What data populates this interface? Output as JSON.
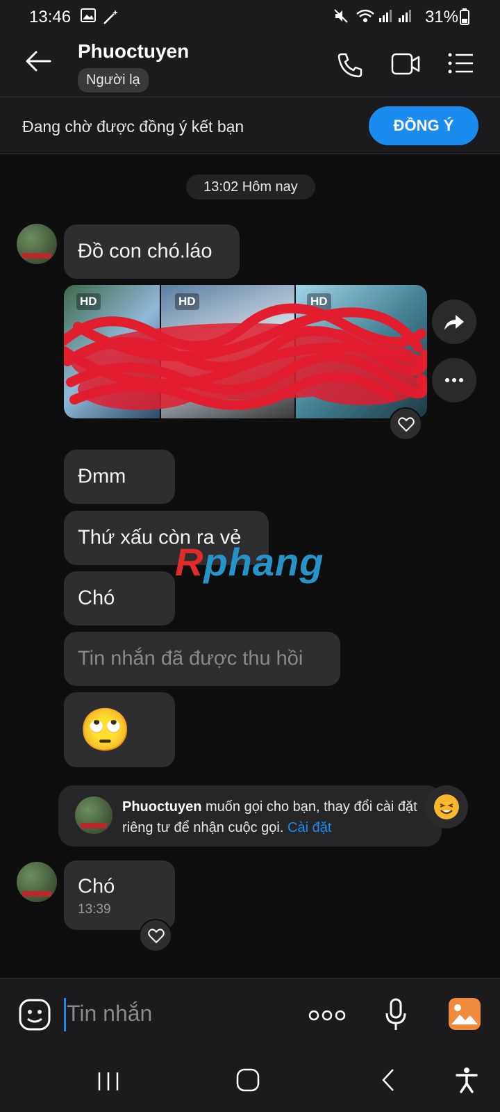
{
  "status": {
    "time": "13:46",
    "battery": "31%"
  },
  "header": {
    "title": "Phuoctuyen",
    "badge": "Người lạ"
  },
  "pending": {
    "text": "Đang chờ được đồng ý kết bạn",
    "button": "ĐỒNG Ý"
  },
  "chat": {
    "time_chip": "13:02 Hôm nay",
    "messages": [
      {
        "text": "Đồ con chó.láo"
      },
      {
        "text": "Đmm"
      },
      {
        "text": "Thứ xấu còn ra vẻ"
      },
      {
        "text": "Chó"
      },
      {
        "text": "Tin nhắn đã được thu hồi"
      },
      {
        "text": "🙄"
      }
    ],
    "media": {
      "hd_labels": [
        "HD",
        "HD",
        "HD"
      ]
    },
    "notice": {
      "name": "Phuoctuyen",
      "text": " muốn gọi cho bạn, thay đổi cài đặt riêng tư để nhận cuộc gọi. ",
      "link": "Cài đặt"
    },
    "last_message": {
      "text": "Chó",
      "time": "13:39"
    }
  },
  "composer": {
    "placeholder": "Tin nhắn"
  },
  "watermark": {
    "first": "R",
    "rest": "phang"
  },
  "colors": {
    "accent": "#1a8cf0",
    "bubble": "#2e2e30",
    "background": "#0e0e0f"
  }
}
